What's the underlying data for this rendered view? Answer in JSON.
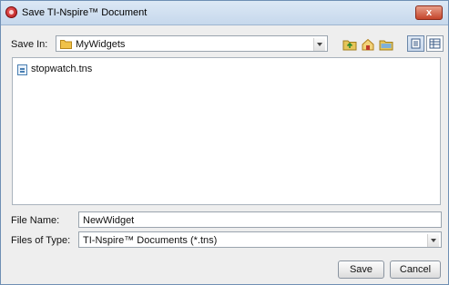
{
  "window": {
    "title": "Save TI-Nspire™ Document",
    "close_label": "x"
  },
  "location": {
    "label": "Save In:",
    "folder": "MyWidgets"
  },
  "toolbar": {
    "icons": [
      "up-folder-icon",
      "home-icon",
      "new-folder-icon",
      "list-view-icon",
      "details-view-icon"
    ]
  },
  "files": [
    {
      "name": "stopwatch.tns"
    }
  ],
  "filename": {
    "label": "File Name:",
    "value": "NewWidget"
  },
  "filetype": {
    "label": "Files of Type:",
    "value": "TI-Nspire™ Documents (*.tns)"
  },
  "buttons": {
    "save": "Save",
    "cancel": "Cancel"
  },
  "colors": {
    "title_bar": "#c6d8ec",
    "close": "#c4442b",
    "folder": "#f0c24a",
    "background": "#eeeeee"
  }
}
